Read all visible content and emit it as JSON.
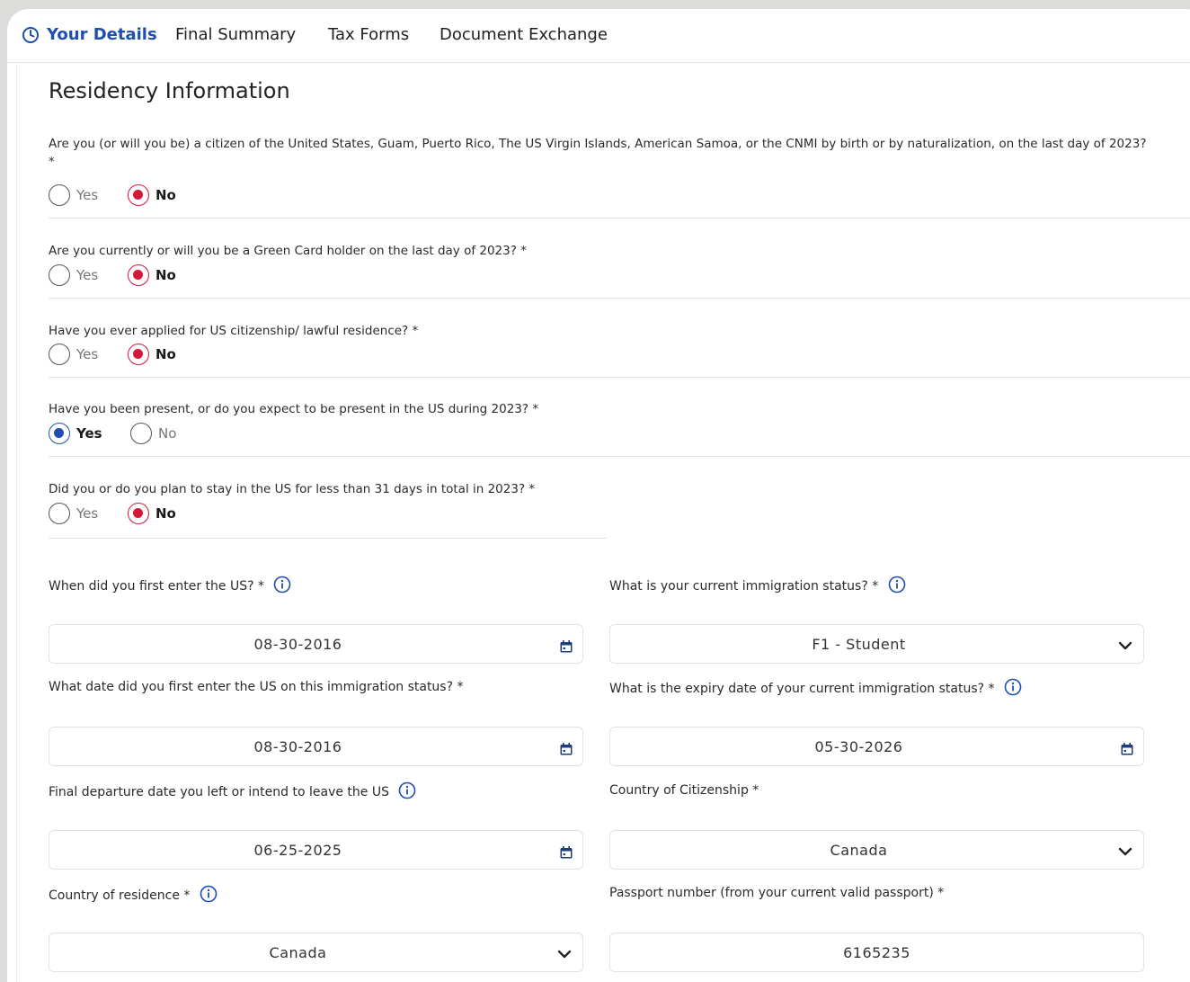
{
  "tabs": [
    {
      "label": "Your Details",
      "active": true
    },
    {
      "label": "Final Summary"
    },
    {
      "label": "Tax Forms"
    },
    {
      "label": "Document Exchange"
    }
  ],
  "section_title": "Residency Information",
  "questions": [
    {
      "text": "Are you (or will you be) a citizen of the United States, Guam, Puerto Rico, The US Virgin Islands, American Samoa, or the CNMI by birth or by naturalization, on the last day of 2023?",
      "asterisk_line": "*",
      "yes": "Yes",
      "no": "No",
      "selected": "No"
    },
    {
      "text": "Are you currently or will you be a Green Card holder on the last day of 2023? *",
      "yes": "Yes",
      "no": "No",
      "selected": "No"
    },
    {
      "text": "Have you ever applied for US citizenship/ lawful residence? *",
      "yes": "Yes",
      "no": "No",
      "selected": "No"
    },
    {
      "text": "Have you been present, or do you expect to be present in the US during 2023? *",
      "yes": "Yes",
      "no": "No",
      "selected": "Yes"
    },
    {
      "text": "Did you or do you plan to stay in the US for less than 31 days in total in 2023? *",
      "yes": "Yes",
      "no": "No",
      "selected": "No"
    }
  ],
  "fields": {
    "first_entry": {
      "label": "When did you first enter the US? *",
      "value": "08-30-2016"
    },
    "immigration_status": {
      "label": "What is your current immigration status? *",
      "value": "F1 - Student"
    },
    "first_entry_status": {
      "label": "What date did you first enter the US on this immigration status? *",
      "value": "08-30-2016"
    },
    "status_expiry": {
      "label": "What is the expiry date of your current immigration status? *",
      "value": "05-30-2026"
    },
    "departure": {
      "label": "Final departure date you left or intend to leave the US",
      "value": "06-25-2025"
    },
    "citizenship": {
      "label": "Country of Citizenship *",
      "value": "Canada"
    },
    "residence": {
      "label": "Country of residence *",
      "value": "Canada"
    },
    "passport": {
      "label": "Passport number (from your current valid passport) *",
      "value": "6165235"
    }
  },
  "colors": {
    "accent_blue": "#1e4fb0",
    "selected_red": "#d2193a"
  }
}
